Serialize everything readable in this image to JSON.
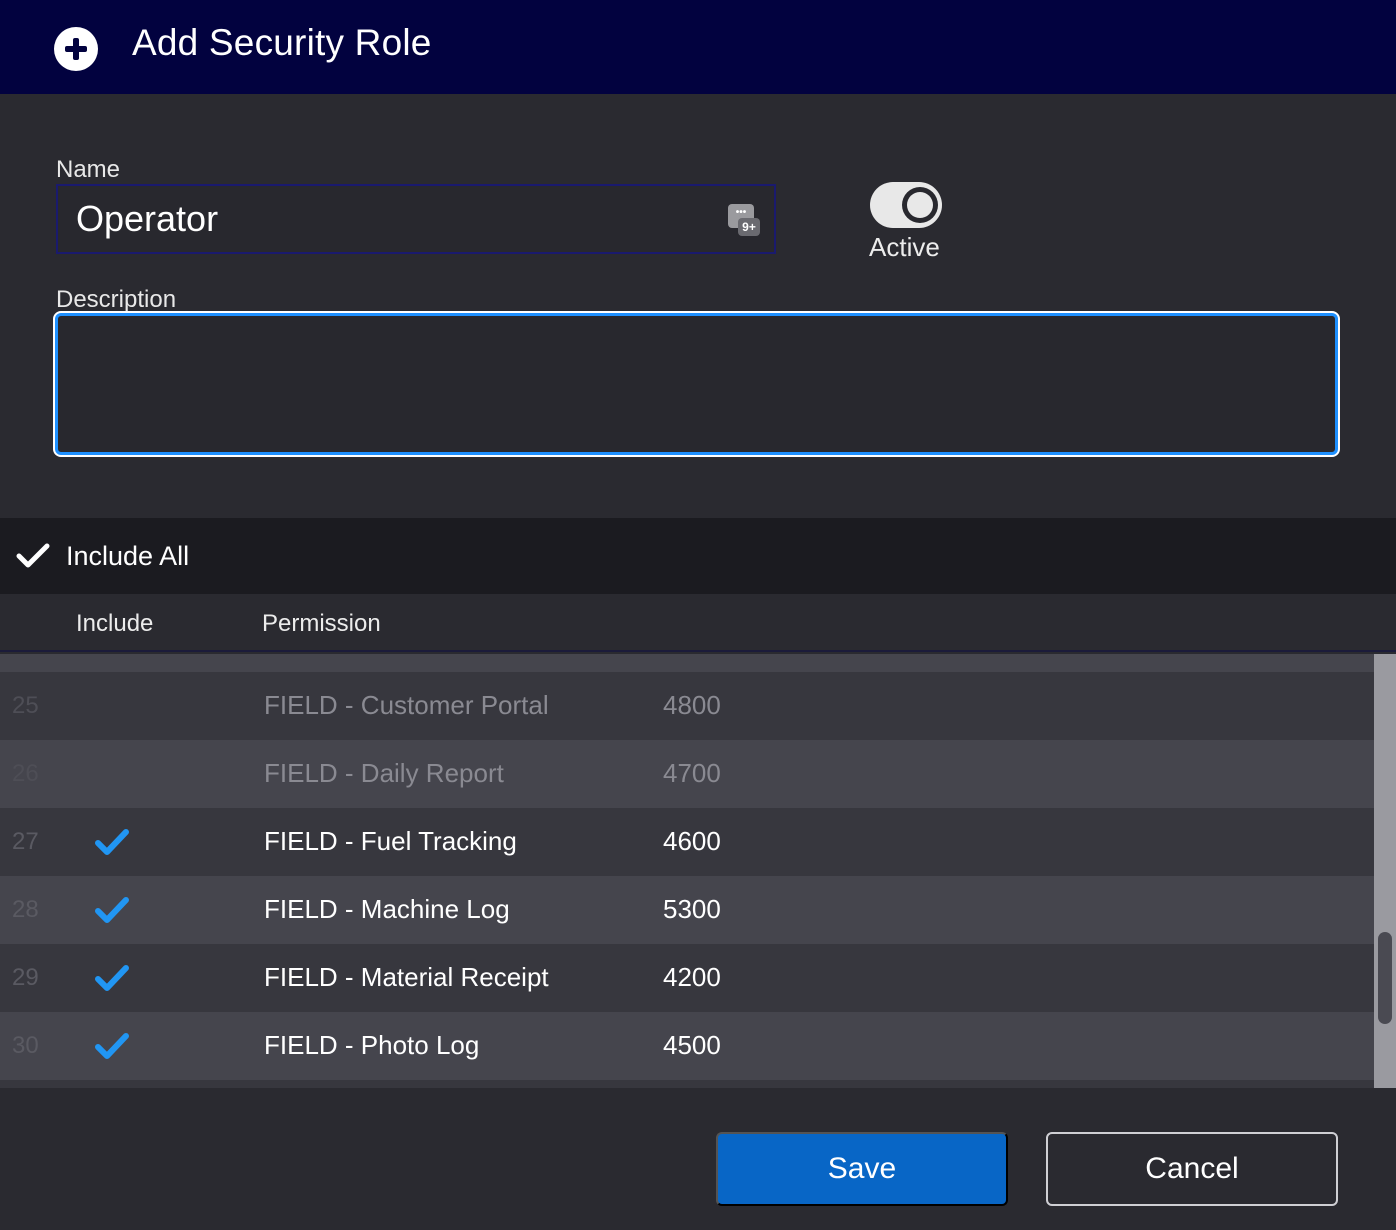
{
  "header": {
    "title": "Add Security Role",
    "icon": "plus-circle-icon"
  },
  "form": {
    "name_label": "Name",
    "name_value": "Operator",
    "active_label": "Active",
    "active": true,
    "description_label": "Description",
    "description_value": ""
  },
  "include_all": {
    "label": "Include All",
    "checked": true
  },
  "table": {
    "columns": [
      "Include",
      "Permission"
    ],
    "rows": [
      {
        "num": "25",
        "included": false,
        "permission": "FIELD - Customer Portal",
        "code": "4800"
      },
      {
        "num": "26",
        "included": false,
        "permission": "FIELD - Daily Report",
        "code": "4700"
      },
      {
        "num": "27",
        "included": true,
        "permission": "FIELD - Fuel Tracking",
        "code": "4600"
      },
      {
        "num": "28",
        "included": true,
        "permission": "FIELD - Machine Log",
        "code": "5300"
      },
      {
        "num": "29",
        "included": true,
        "permission": "FIELD - Material Receipt",
        "code": "4200"
      },
      {
        "num": "30",
        "included": true,
        "permission": "FIELD - Photo Log",
        "code": "4500"
      }
    ]
  },
  "buttons": {
    "save": "Save",
    "cancel": "Cancel"
  },
  "colors": {
    "header_bg": "#02023f",
    "accent_blue": "#0866c6",
    "focus_border": "#1e90ff",
    "check_blue": "#2196f3"
  }
}
